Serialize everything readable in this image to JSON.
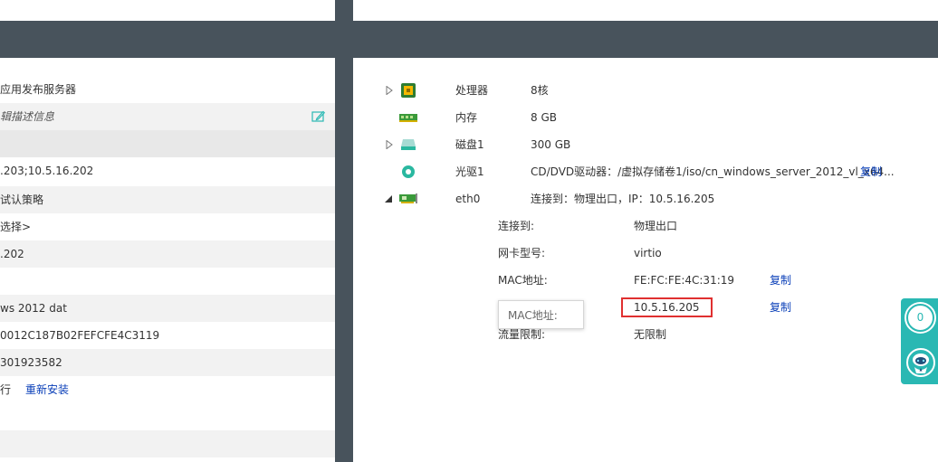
{
  "left": {
    "rows": [
      {
        "text": "应用发布服务器"
      },
      {
        "text": "辑描述信息"
      },
      {
        "text": ""
      },
      {
        "text": ".203;10.5.16.202"
      },
      {
        "text": "试认策略"
      },
      {
        "text": "选择>"
      },
      {
        "text": ".202"
      },
      {
        "text": ""
      },
      {
        "text": "ws 2012 dat"
      },
      {
        "text": "0012C187B02FEFCFE4C3119"
      },
      {
        "text": "301923582"
      },
      {
        "text": "行",
        "link": "重新安装"
      }
    ]
  },
  "hardware": [
    {
      "name": "处理器",
      "value": "8核"
    },
    {
      "name": "内存",
      "value": "8 GB"
    },
    {
      "name": "磁盘1",
      "value": "300 GB"
    },
    {
      "name": "光驱1",
      "value": "CD/DVD驱动器：/虚拟存储卷1/iso/cn_windows_server_2012_vl_x64...",
      "copy": "复制"
    },
    {
      "name": "eth0",
      "value": "连接到：物理出口，IP：10.5.16.205"
    }
  ],
  "nic": [
    {
      "key": "连接到:",
      "value": "物理出口"
    },
    {
      "key": "网卡型号:",
      "value": "virtio"
    },
    {
      "key": "MAC地址:",
      "value": "FE:FC:FE:4C:31:19",
      "copy": "复制"
    },
    {
      "key": "",
      "value": "10.5.16.205",
      "copy": "复制"
    },
    {
      "key": "流量限制:",
      "value": "无限制"
    }
  ],
  "tooltip": "MAC地址:",
  "widget": {
    "count": "0"
  },
  "colors": {
    "accent": "#2ab8b3",
    "band": "#48535c",
    "link": "#0a3fb8",
    "highlight": "#e03030"
  }
}
